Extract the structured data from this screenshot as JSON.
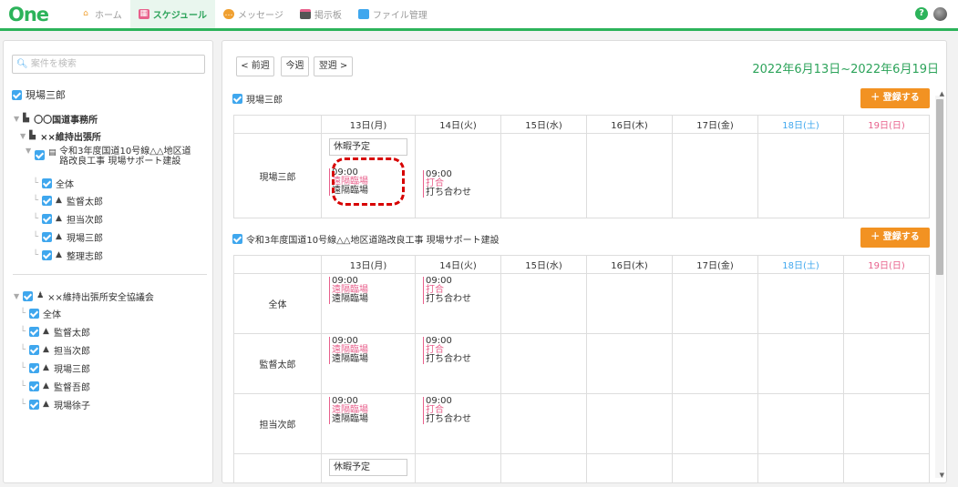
{
  "app": {
    "logo": "One"
  },
  "nav": [
    {
      "label": "ホーム",
      "icon": "home-icon",
      "color": "#f0a030"
    },
    {
      "label": "スケジュール",
      "icon": "calendar-icon",
      "color": "#e8618c",
      "active": true
    },
    {
      "label": "メッセージ",
      "icon": "message-icon",
      "color": "#f0a030"
    },
    {
      "label": "掲示板",
      "icon": "board-icon",
      "color": "#e8618c"
    },
    {
      "label": "ファイル管理",
      "icon": "folder-icon",
      "color": "#3fa7ee"
    }
  ],
  "header": {
    "help": "?"
  },
  "sidebar": {
    "search_placeholder": "案件を検索",
    "self": "現場三郎",
    "tree": [
      {
        "label": "〇〇国道事務所"
      },
      {
        "label": "××維持出張所"
      },
      {
        "label": "令和3年度国道10号線△△地区道",
        "label2": "路改良工事 現場サポート建設"
      },
      {
        "label": "全体"
      },
      {
        "label": "監督太郎"
      },
      {
        "label": "担当次郎"
      },
      {
        "label": "現場三郎"
      },
      {
        "label": "整理志郎"
      }
    ],
    "tree2": [
      {
        "label": "××維持出張所安全協議会"
      },
      {
        "label": "全体"
      },
      {
        "label": "監督太郎"
      },
      {
        "label": "担当次郎"
      },
      {
        "label": "現場三郎"
      },
      {
        "label": "監督吾郎"
      },
      {
        "label": "現場徐子"
      }
    ]
  },
  "toolbar": {
    "prev": "< 前週",
    "today": "今週",
    "next": "翌週 >",
    "range": "2022年6月13日~2022年6月19日",
    "register": "＋ 登録する"
  },
  "days": [
    "13日(月)",
    "14日(火)",
    "15日(水)",
    "16日(木)",
    "17日(金)",
    "18日(土)",
    "19日(日)"
  ],
  "section1": {
    "title": "現場三郎",
    "rows": [
      {
        "name": "現場三郎",
        "holiday": "休暇予定",
        "mon": {
          "time": "09:00",
          "place": "遠隔臨場",
          "title": "遠隔臨場"
        },
        "tue": {
          "time": "09:00",
          "place": "打合",
          "title": "打ち合わせ"
        }
      }
    ]
  },
  "section2": {
    "title": "令和3年度国道10号線△△地区道路改良工事 現場サポート建設",
    "rows": [
      {
        "name": "全体",
        "mon": {
          "time": "09:00",
          "place": "遠隔臨場",
          "title": "遠隔臨場"
        },
        "tue": {
          "time": "09:00",
          "place": "打合",
          "title": "打ち合わせ"
        }
      },
      {
        "name": "監督太郎",
        "mon": {
          "time": "09:00",
          "place": "遠隔臨場",
          "title": "遠隔臨場"
        },
        "tue": {
          "time": "09:00",
          "place": "打合",
          "title": "打ち合わせ"
        }
      },
      {
        "name": "担当次郎",
        "mon": {
          "time": "09:00",
          "place": "遠隔臨場",
          "title": "遠隔臨場"
        },
        "tue": {
          "time": "09:00",
          "place": "打合",
          "title": "打ち合わせ"
        }
      },
      {
        "name": "",
        "holiday": "休暇予定"
      }
    ]
  }
}
